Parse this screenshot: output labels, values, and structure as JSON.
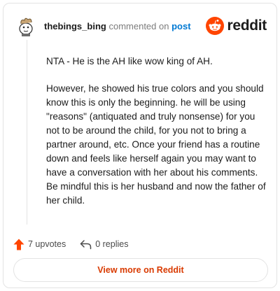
{
  "comment": {
    "username": "thebings_bing",
    "action_text": "commented on",
    "post_link": "post",
    "paragraphs": [
      "NTA - He is the AH like wow king of AH.",
      "However, he showed his true colors and you should know this is only the beginning. he will be using \"reasons\" (antiquated and truly nonsense) for you not to be around the child, for you not to bring a partner around, etc. Once your friend has a routine down and feels like herself again you may want to have a conversation with her about his comments. Be mindful this is her husband and now the father of her child."
    ]
  },
  "brand": {
    "name": "reddit",
    "icon": "reddit-logo-icon",
    "color": "#ff4500"
  },
  "actions": {
    "upvotes": "7 upvotes",
    "replies": "0 replies",
    "upvote_icon": "upvote-arrow-icon",
    "reply_icon": "reply-arrow-icon",
    "upvote_color": "#ff4500"
  },
  "view_more": {
    "label": "View more on Reddit",
    "color": "#d93a00"
  }
}
